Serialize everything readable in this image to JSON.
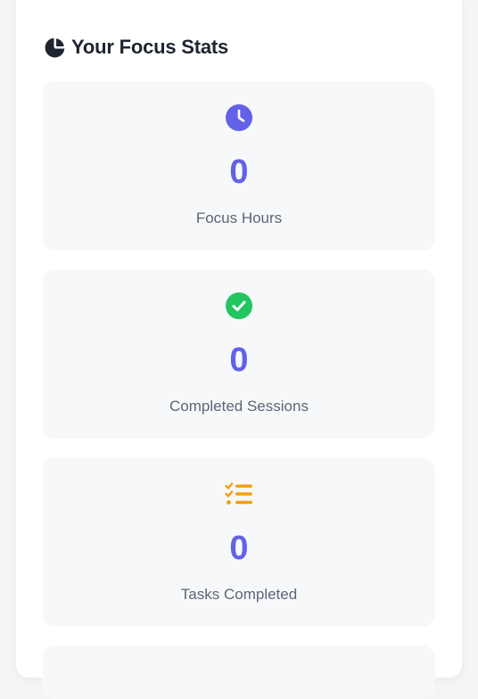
{
  "stats_panel": {
    "title": "Your Focus Stats",
    "title_icon": "chart-pie-icon",
    "cards": [
      {
        "icon": "clock-icon",
        "icon_color": "#6361e8",
        "value": "0",
        "label": "Focus Hours"
      },
      {
        "icon": "check-circle-icon",
        "icon_color": "#22c55e",
        "value": "0",
        "label": "Completed Sessions"
      },
      {
        "icon": "tasks-list-icon",
        "icon_color": "#f59e0b",
        "value": "0",
        "label": "Tasks Completed"
      }
    ]
  },
  "colors": {
    "value_accent": "#6361e8",
    "heading": "#1e2530",
    "label": "#5d6575",
    "card_bg": "#f7f8fa"
  }
}
